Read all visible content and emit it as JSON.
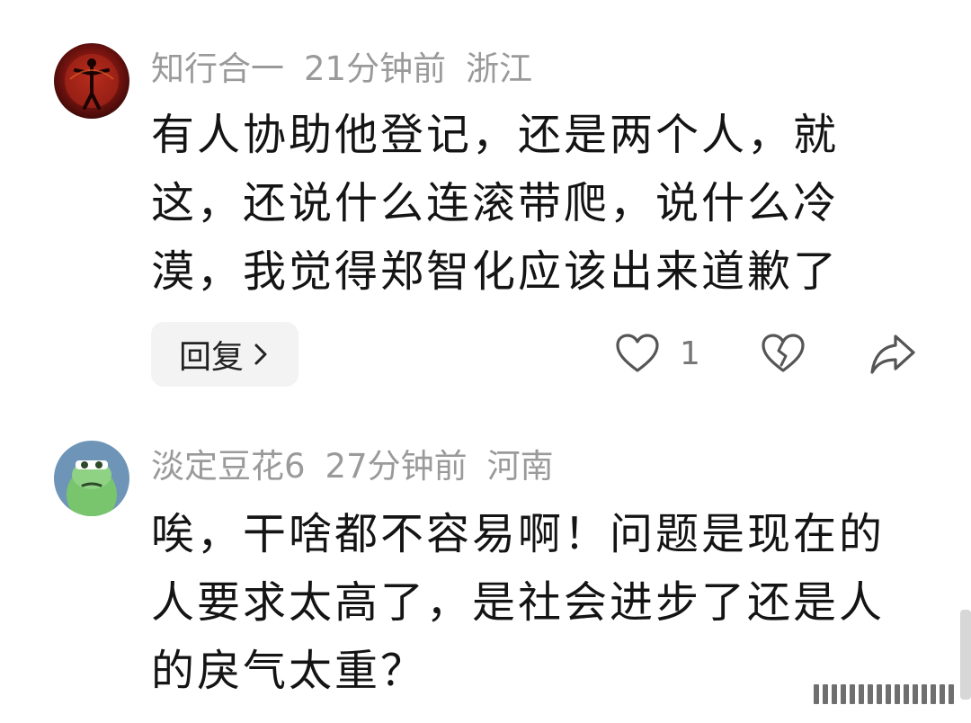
{
  "comments": [
    {
      "username": "知行合一",
      "time": "21分钟前",
      "location": "浙江",
      "text": "有人协助他登记，还是两个人，就这，还说什么连滚带爬，说什么冷漠，我觉得郑智化应该出来道歉了",
      "reply_label": "回复",
      "like_count": "1",
      "avatar_icon": "red-figure-avatar"
    },
    {
      "username": "淡定豆花6",
      "time": "27分钟前",
      "location": "河南",
      "text": "唉，干啥都不容易啊！问题是现在的人要求太高了，是社会进步了还是人的戾气太重？",
      "avatar_icon": "green-cartoon-avatar"
    }
  ],
  "colors": {
    "meta_gray": "#9a9a9a",
    "text": "#141414",
    "reply_bg": "#f3f3f3",
    "avatar2_bg": "#6e95b7",
    "avatar2_face": "#79c56e"
  }
}
